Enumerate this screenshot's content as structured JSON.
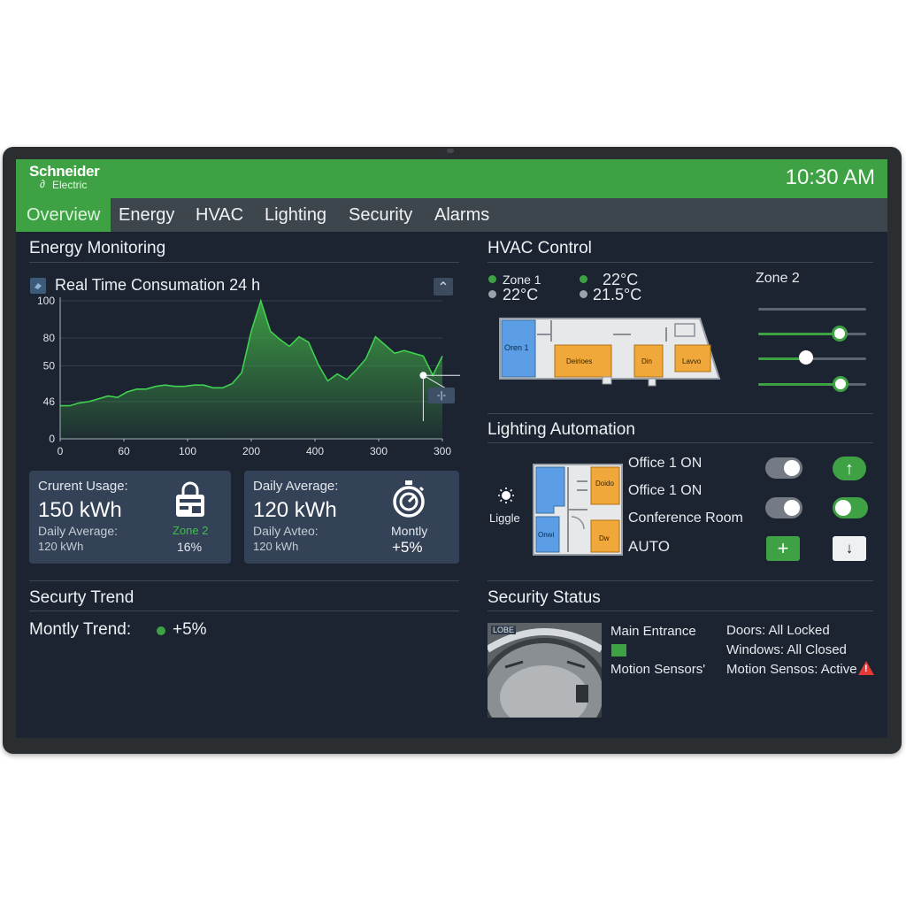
{
  "header": {
    "brand_name": "Schneider",
    "brand_sub": "Electric",
    "clock": "10:30 AM"
  },
  "tabs": [
    "Overview",
    "Energy",
    "HVAC",
    "Lighting",
    "Security",
    "Alarms"
  ],
  "energy": {
    "title": "Energy Monitoring",
    "chart_title": "Real Time Consumation 24 h",
    "collapse_glyph": "⌃",
    "marker_label": "-|-",
    "chart_data": {
      "type": "area",
      "title": "Real Time Consumation 24 h",
      "x_tick_labels": [
        "0",
        "60",
        "100",
        "200",
        "400",
        "300",
        "300"
      ],
      "y_tick_labels": [
        "100",
        "80",
        "50",
        "46",
        "0"
      ],
      "ylim": [
        0,
        100
      ],
      "x": [
        0,
        5,
        10,
        15,
        20,
        25,
        30,
        35,
        40,
        45,
        50,
        55,
        60,
        65,
        70,
        75,
        80,
        85,
        90,
        95,
        100,
        105,
        110,
        115,
        120,
        125,
        130,
        135,
        140,
        145,
        150,
        155,
        160,
        165,
        170,
        175,
        180,
        185,
        190,
        195,
        200
      ],
      "values": [
        24,
        24,
        26,
        27,
        29,
        31,
        30,
        34,
        36,
        36,
        38,
        39,
        38,
        38,
        39,
        39,
        37,
        37,
        40,
        48,
        78,
        100,
        78,
        72,
        67,
        74,
        70,
        54,
        42,
        47,
        43,
        50,
        58,
        74,
        68,
        62,
        64,
        62,
        60,
        46,
        60
      ],
      "marker": {
        "x": 190,
        "y": 46
      },
      "grid": true,
      "line_color": "#3fd14f",
      "fill_color": "#3ea244"
    },
    "cards": [
      {
        "label": "Crurent Usage:",
        "value": "150 kWh",
        "sub_label": "Daily Average:",
        "sub_value": "120 kWh",
        "right_label": "Zone 2",
        "right_value": "16%",
        "icon": "lock-icon"
      },
      {
        "label": "Daily Average:",
        "value": "120 kWh",
        "sub_label": "Daily Avteo:",
        "sub_value": "120 kWh",
        "right_label": "Montly",
        "right_value": "+5%",
        "icon": "stopwatch-icon"
      }
    ]
  },
  "security_trend": {
    "title": "Securty Trend",
    "label": "Montly Trend:",
    "value": "+5%"
  },
  "hvac": {
    "title": "HVAC Control",
    "zone1_label": "Zone 1",
    "zone1_temp": "22°C",
    "temp_a": "22°C",
    "temp_b": "21.5°C",
    "zone2_label": "Zone 2",
    "rooms": [
      "Oren 1",
      "Deirioes",
      "Din",
      "Lavvo"
    ],
    "sliders": [
      0.0,
      0.75,
      0.45,
      0.76
    ]
  },
  "lighting": {
    "title": "Lighting Automation",
    "bulb_label": "Liggle",
    "rooms": [
      "Doido",
      "Onwi",
      "Dw"
    ],
    "items": [
      "Office 1 ON",
      "Office 1 ON",
      "Conference Room",
      "AUTO"
    ],
    "up_glyph": "↑",
    "plus_glyph": "+",
    "down_glyph": "↓"
  },
  "security_status": {
    "title": "Security Status",
    "cam_label": "LOBE",
    "main_entrance": "Main Entrance",
    "motion_left": "Motion Sensors'",
    "doors": "Doors: All Locked",
    "windows": "Windows: All Closed",
    "motion_right": "Motion Sensos: Active",
    "alert_glyph": "!"
  }
}
